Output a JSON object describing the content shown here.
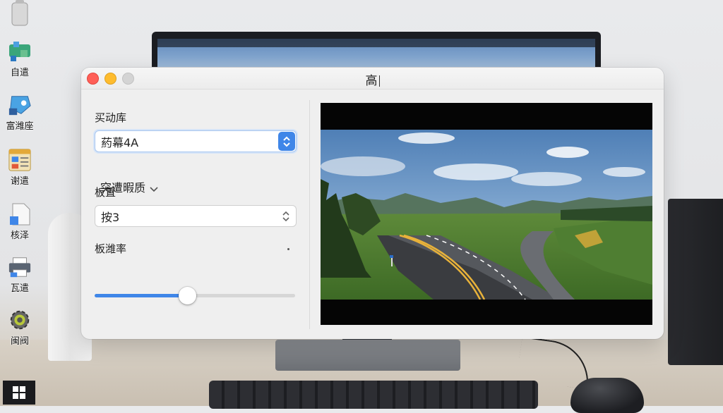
{
  "window": {
    "title": "高",
    "controls": [
      "close",
      "minimize",
      "maximize"
    ]
  },
  "settings": {
    "frame_rate_label": "买动库",
    "source_value": "葯幕4A",
    "disclosure_label": "突遭暇质",
    "section2_label": "板置",
    "count_value": "按3",
    "slider_label": "板潍率",
    "slider_value": 0.46
  },
  "desktop": {
    "icons": [
      {
        "label": "",
        "icon": "trash-icon"
      },
      {
        "label": "自遣",
        "icon": "network-icon"
      },
      {
        "label": "富潍座",
        "icon": "app-icon"
      },
      {
        "label": "谢遣",
        "icon": "control-panel-icon"
      },
      {
        "label": "核泽",
        "icon": "document-icon"
      },
      {
        "label": "瓦遣",
        "icon": "printer-icon"
      },
      {
        "label": "闽阀",
        "icon": "gear-icon"
      }
    ]
  },
  "colors": {
    "accent": "#3f86e8",
    "close": "#ff5f57",
    "minimize": "#febc2e",
    "maximize": "#d4d4d4"
  }
}
